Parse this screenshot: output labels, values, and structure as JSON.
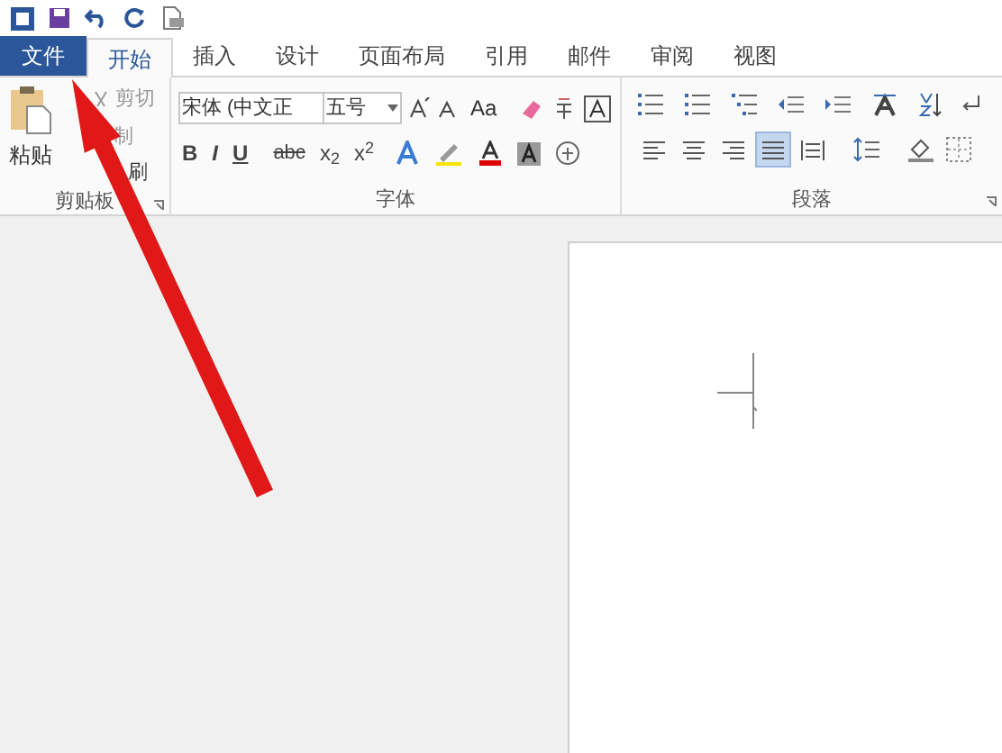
{
  "tabs": [
    {
      "label": "文件",
      "kind": "file",
      "selected": false
    },
    {
      "label": "开始",
      "kind": "tab",
      "selected": true
    },
    {
      "label": "插入",
      "kind": "tab",
      "selected": false
    },
    {
      "label": "设计",
      "kind": "tab",
      "selected": false
    },
    {
      "label": "页面布局",
      "kind": "tab",
      "selected": false
    },
    {
      "label": "引用",
      "kind": "tab",
      "selected": false
    },
    {
      "label": "邮件",
      "kind": "tab",
      "selected": false
    },
    {
      "label": "审阅",
      "kind": "tab",
      "selected": false
    },
    {
      "label": "视图",
      "kind": "tab",
      "selected": false
    }
  ],
  "clipboard": {
    "paste": "粘贴",
    "cut": "剪切",
    "copy": "制",
    "format_painter": "刷",
    "group_label": "剪贴板"
  },
  "font": {
    "font_name": "宋体 (中文正",
    "font_size": "五号",
    "change_case": "Aa",
    "format_buttons": [
      "B",
      "I",
      "U",
      "abc",
      "x$_{2}$",
      "x$^{2}$"
    ],
    "group_label": "字体"
  },
  "paragraph": {
    "alignments": [
      {
        "kind": "left",
        "selected": false
      },
      {
        "kind": "center",
        "selected": false
      },
      {
        "kind": "right",
        "selected": false
      },
      {
        "kind": "justify",
        "selected": true
      },
      {
        "kind": "distributed",
        "selected": false
      }
    ],
    "group_label": "段落"
  }
}
